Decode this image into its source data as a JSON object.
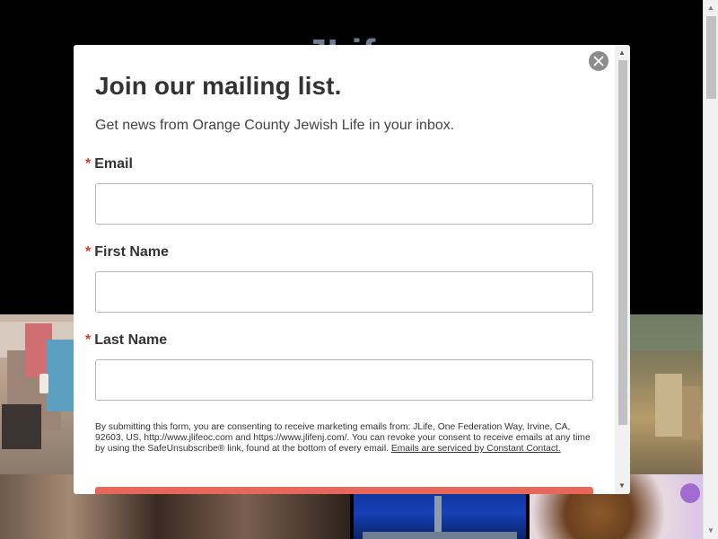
{
  "background": {
    "logo_text": "JLife"
  },
  "modal": {
    "title": "Join our mailing list.",
    "subtitle": "Get news from Orange County Jewish Life in your inbox.",
    "required_marker": "*",
    "fields": [
      {
        "label": "Email",
        "value": "",
        "placeholder": ""
      },
      {
        "label": "First Name",
        "value": "",
        "placeholder": ""
      },
      {
        "label": "Last Name",
        "value": "",
        "placeholder": ""
      }
    ],
    "consent_text": "By submitting this form, you are consenting to receive marketing emails from: JLife, One Federation Way, Irvine, CA, 92603, US, http://www.jlifeoc.com and https://www.jlifenj.com/. You can revoke your consent to receive emails at any time by using the SafeUnsubscribe® link, found at the bottom of every email.",
    "consent_link": "Emails are serviced by Constant Contact.",
    "submit_label": ""
  },
  "icons": {
    "close": "close-icon",
    "scroll_up": "scroll-up-arrow-icon",
    "scroll_down": "scroll-down-arrow-icon"
  },
  "colors": {
    "required": "#d9392b",
    "submit": "#e8675b",
    "close_button": "#8c8c8c"
  }
}
